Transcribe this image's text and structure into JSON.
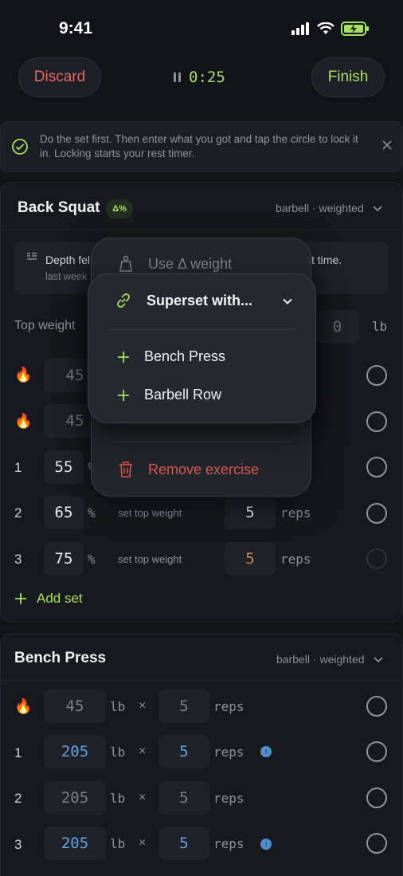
{
  "status_bar": {
    "time": "9:41"
  },
  "header": {
    "discard_label": "Discard",
    "timer": "0:25",
    "finish_label": "Finish"
  },
  "banner": {
    "text": "Do the set first. Then enter what you got and tap the circle to lock it in. Locking starts your rest timer."
  },
  "exercise1": {
    "title": "Back Squat",
    "badge": "Δ%",
    "meta": "barbell · weighted",
    "note_text": "Depth fel",
    "note_tail": "xt time.",
    "note_sub": "last week",
    "top_weight_label": "Top weight",
    "top_weight_value": "0",
    "top_weight_unit": "lb",
    "warmups": [
      {
        "value": "45"
      },
      {
        "value": "45"
      }
    ],
    "sets": [
      {
        "num": "1",
        "pct": "55",
        "unit": "%",
        "hint": "",
        "reps": "",
        "reps_label": ""
      },
      {
        "num": "2",
        "pct": "65",
        "unit": "%",
        "hint": "set top weight",
        "reps": "5",
        "reps_label": "reps"
      },
      {
        "num": "3",
        "pct": "75",
        "unit": "%",
        "hint": "set top weight",
        "reps": "5",
        "reps_label": "reps"
      }
    ],
    "add_set_label": "Add set"
  },
  "exercise2": {
    "title": "Bench Press",
    "meta": "barbell · weighted",
    "rows": [
      {
        "num": "",
        "weight": "45",
        "unit": "lb",
        "x": "×",
        "reps": "5",
        "reps_label": "reps"
      },
      {
        "num": "1",
        "weight": "205",
        "unit": "lb",
        "x": "×",
        "reps": "5",
        "reps_label": "reps"
      },
      {
        "num": "2",
        "weight": "205",
        "unit": "lb",
        "x": "×",
        "reps": "5",
        "reps_label": "reps"
      },
      {
        "num": "3",
        "weight": "205",
        "unit": "lb",
        "x": "×",
        "reps": "5",
        "reps_label": "reps"
      }
    ]
  },
  "menu_back": {
    "use_delta": "Use Δ weight",
    "remove": "Remove exercise"
  },
  "menu_front": {
    "superset_label": "Superset with...",
    "options": [
      "Bench Press",
      "Barbell Row"
    ]
  },
  "colors": {
    "accent": "#a5e05f",
    "danger": "#e06a5f",
    "blue": "#62a3dd",
    "orange": "#c9874a"
  }
}
